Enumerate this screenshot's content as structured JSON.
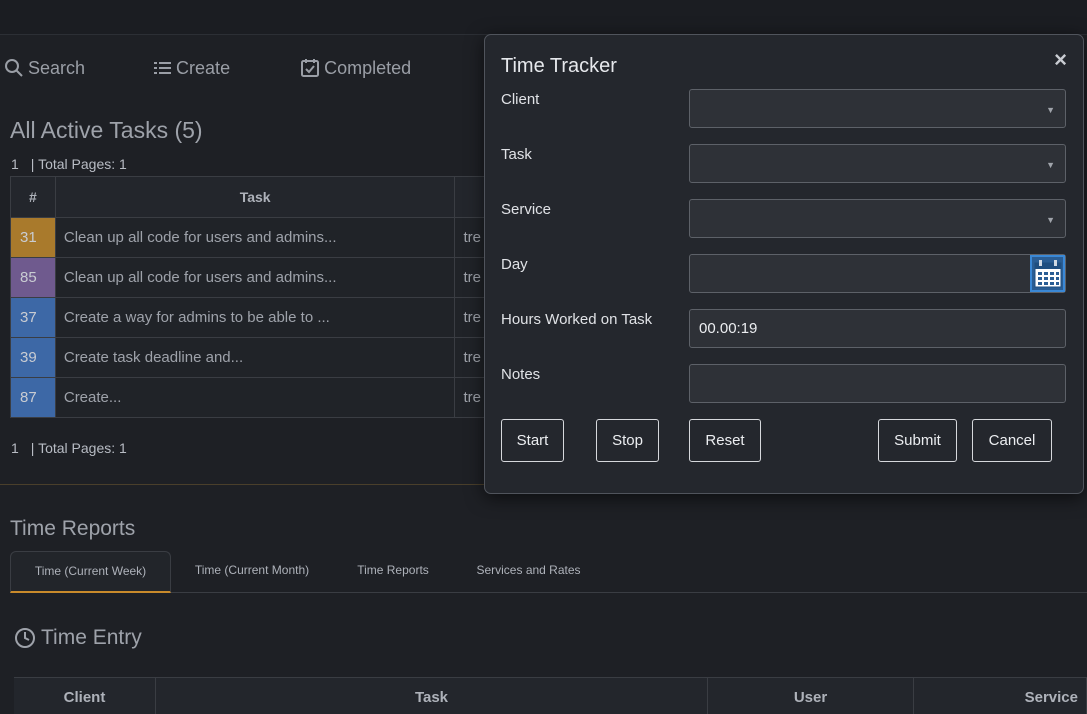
{
  "nav": {
    "search": "Search",
    "create": "Create",
    "completed": "Completed"
  },
  "tasks": {
    "heading": "All Active Tasks (5)",
    "pager_page": "1",
    "pager_total": "| Total Pages: 1",
    "columns": [
      "#",
      "Task"
    ],
    "rows": [
      {
        "num": "31",
        "color": "#a97a2c",
        "task": "Clean up all code for users and admins...",
        "user": "tre"
      },
      {
        "num": "85",
        "color": "#6f5a8e",
        "task": "Clean up all code for users and admins...",
        "user": "tre"
      },
      {
        "num": "37",
        "color": "#3d68a6",
        "task": "Create a way for admins to be able to ...",
        "user": "tre"
      },
      {
        "num": "39",
        "color": "#3d68a6",
        "task": "Create task deadline and...",
        "user": "tre"
      },
      {
        "num": "87",
        "color": "#3d68a6",
        "task": "Create...",
        "user": "tre"
      }
    ]
  },
  "reports": {
    "heading": "Time Reports",
    "tabs": [
      "Time (Current Week)",
      "Time (Current Month)",
      "Time Reports",
      "Services and Rates"
    ],
    "entry_heading": "Time Entry",
    "columns": [
      "Client",
      "Task",
      "User",
      "Service"
    ]
  },
  "modal": {
    "title": "Time Tracker",
    "close": "×",
    "labels": {
      "client": "Client",
      "task": "Task",
      "service": "Service",
      "day": "Day",
      "hours": "Hours Worked on Task",
      "notes": "Notes"
    },
    "values": {
      "client": "",
      "task": "",
      "service": "",
      "day": "",
      "hours": "00.00:19",
      "notes": ""
    },
    "buttons": {
      "start": "Start",
      "stop": "Stop",
      "reset": "Reset",
      "submit": "Submit",
      "cancel": "Cancel"
    }
  },
  "colors": {
    "background": "#1e2025",
    "accent": "#c98a2b",
    "calendar": "#3a88d6"
  }
}
